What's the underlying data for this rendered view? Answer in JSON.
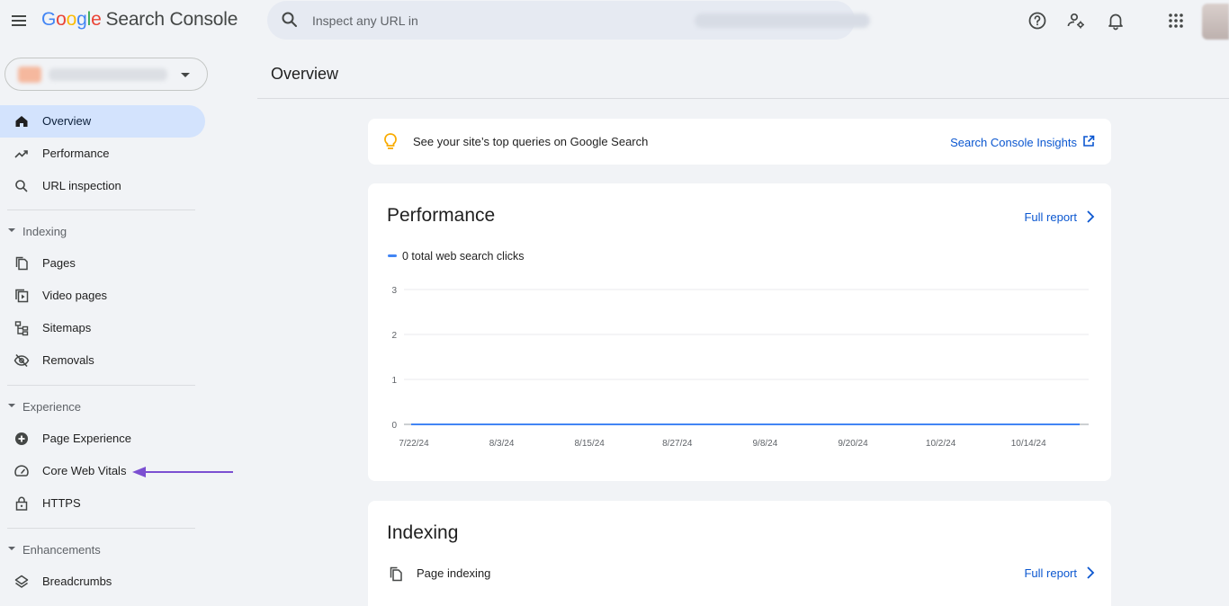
{
  "header": {
    "brand_google": [
      "G",
      "o",
      "o",
      "g",
      "l",
      "e"
    ],
    "brand_rest": "Search Console",
    "search_placeholder": "Inspect any URL in"
  },
  "sidebar": {
    "top_items": [
      {
        "label": "Overview",
        "icon": "home-icon",
        "active": true
      },
      {
        "label": "Performance",
        "icon": "trending-up-icon"
      },
      {
        "label": "URL inspection",
        "icon": "search-icon"
      }
    ],
    "sections": [
      {
        "label": "Indexing",
        "items": [
          {
            "label": "Pages",
            "icon": "pages-icon"
          },
          {
            "label": "Video pages",
            "icon": "video-pages-icon"
          },
          {
            "label": "Sitemaps",
            "icon": "sitemap-icon"
          },
          {
            "label": "Removals",
            "icon": "eye-off-icon"
          }
        ]
      },
      {
        "label": "Experience",
        "items": [
          {
            "label": "Page Experience",
            "icon": "plus-circle-icon"
          },
          {
            "label": "Core Web Vitals",
            "icon": "gauge-icon"
          },
          {
            "label": "HTTPS",
            "icon": "lock-icon"
          }
        ]
      },
      {
        "label": "Enhancements",
        "items": [
          {
            "label": "Breadcrumbs",
            "icon": "layers-icon"
          }
        ]
      }
    ]
  },
  "main": {
    "page_title": "Overview",
    "insight": {
      "text": "See your site’s top queries on Google Search",
      "link": "Search Console Insights"
    },
    "performance": {
      "title": "Performance",
      "full_report": "Full report",
      "legend": "0 total web search clicks"
    },
    "indexing": {
      "title": "Indexing",
      "full_report": "Full report",
      "page_indexing": "Page indexing"
    }
  },
  "colors": {
    "accent": "#0b57d0",
    "active_nav": "#d3e3fd",
    "series": "#4285f4",
    "annotation_arrow": "#7b4fd1"
  },
  "chart_data": {
    "type": "line",
    "x": [
      "7/22/24",
      "8/3/24",
      "8/15/24",
      "8/27/24",
      "9/8/24",
      "9/20/24",
      "10/2/24",
      "10/14/24"
    ],
    "y_ticks": [
      "0",
      "1",
      "2",
      "3"
    ],
    "ylim": [
      0,
      3
    ],
    "series": [
      {
        "name": "0 total web search clicks",
        "values": [
          0,
          0,
          0,
          0,
          0,
          0,
          0,
          0
        ]
      }
    ],
    "grid": true
  }
}
